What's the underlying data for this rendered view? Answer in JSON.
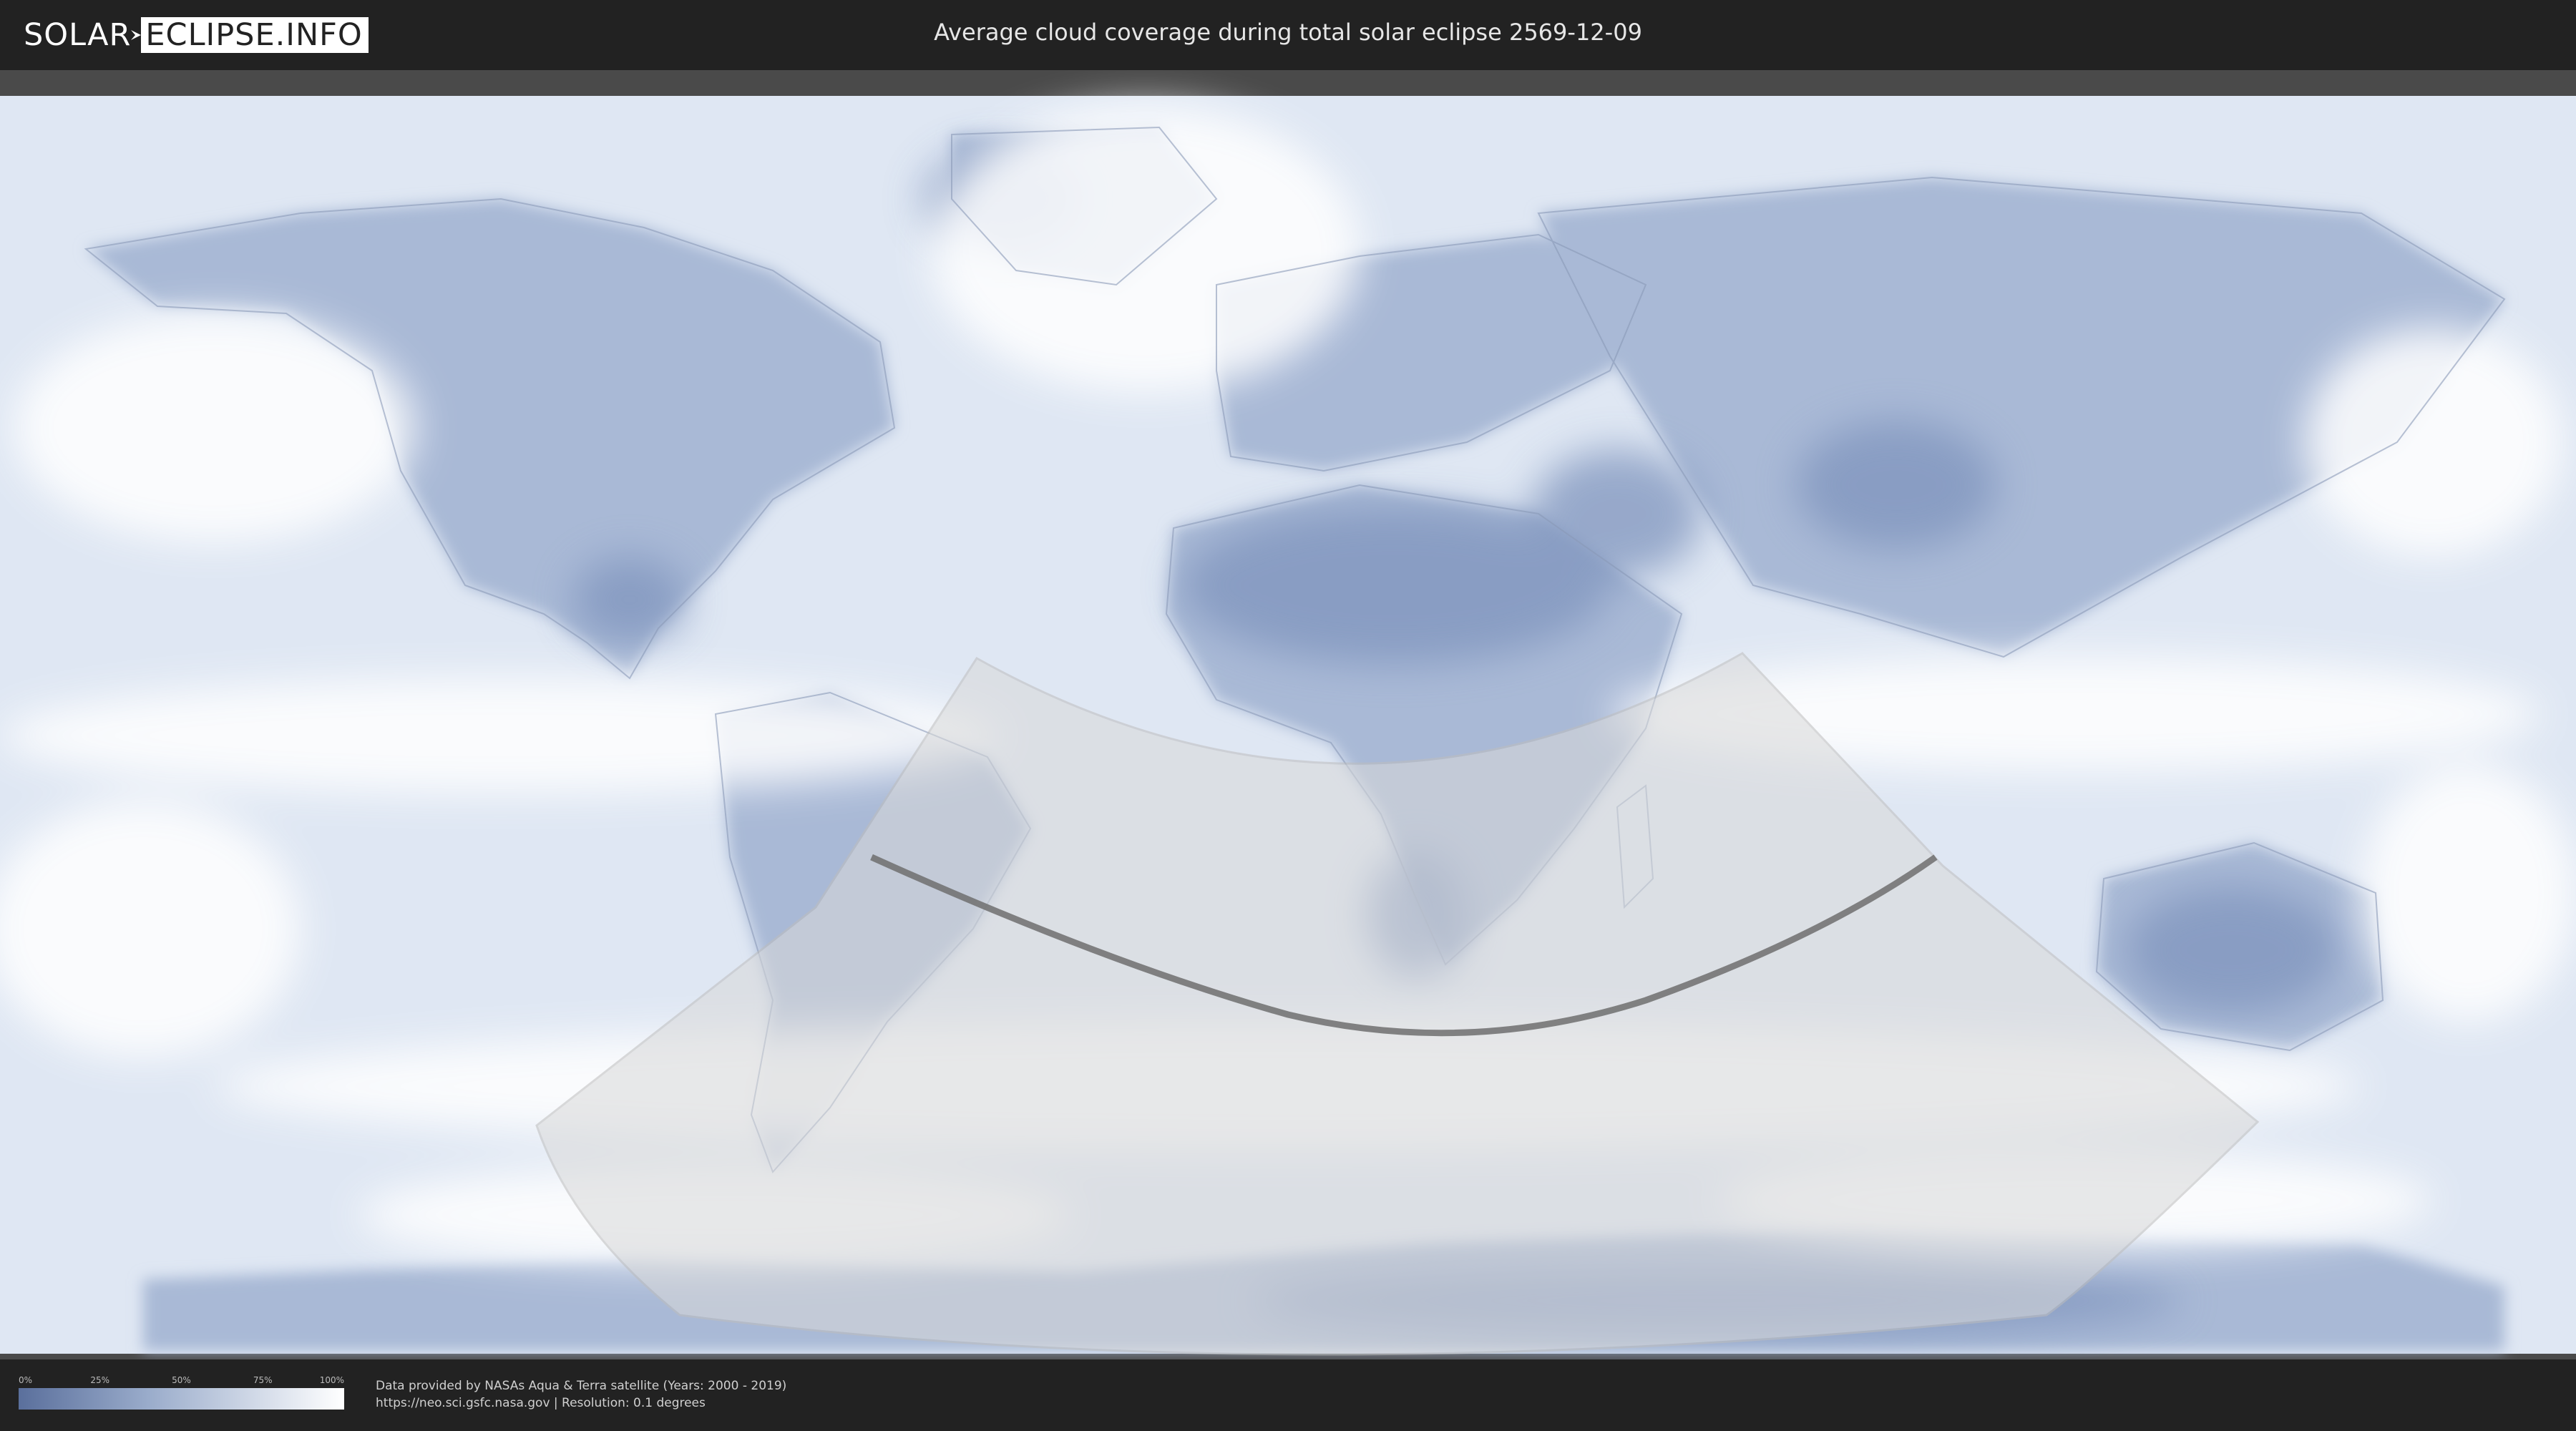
{
  "header": {
    "logo_left": "SOLAR",
    "logo_right": "ECLIPSE.INFO",
    "title": "Average cloud coverage during total solar eclipse 2569-12-09"
  },
  "legend": {
    "ticks": [
      "0%",
      "25%",
      "50%",
      "75%",
      "100%"
    ],
    "colors": {
      "low": "#5a6f9c",
      "mid": "#9aaccb",
      "high": "#ffffff"
    }
  },
  "footer": {
    "line1": "Data provided by NASAs Aqua & Terra satellite (Years: 2000 - 2019)",
    "line2": "https://neo.sci.gsfc.nasa.gov | Resolution: 0.1 degrees"
  },
  "map": {
    "ocean_color": "#e8eef7",
    "cloud_color": "#ffffff",
    "land_color": "#7f94bd",
    "eclipse_zone_color": "#d9d9d9",
    "central_line_color": "#6e6e6e"
  }
}
